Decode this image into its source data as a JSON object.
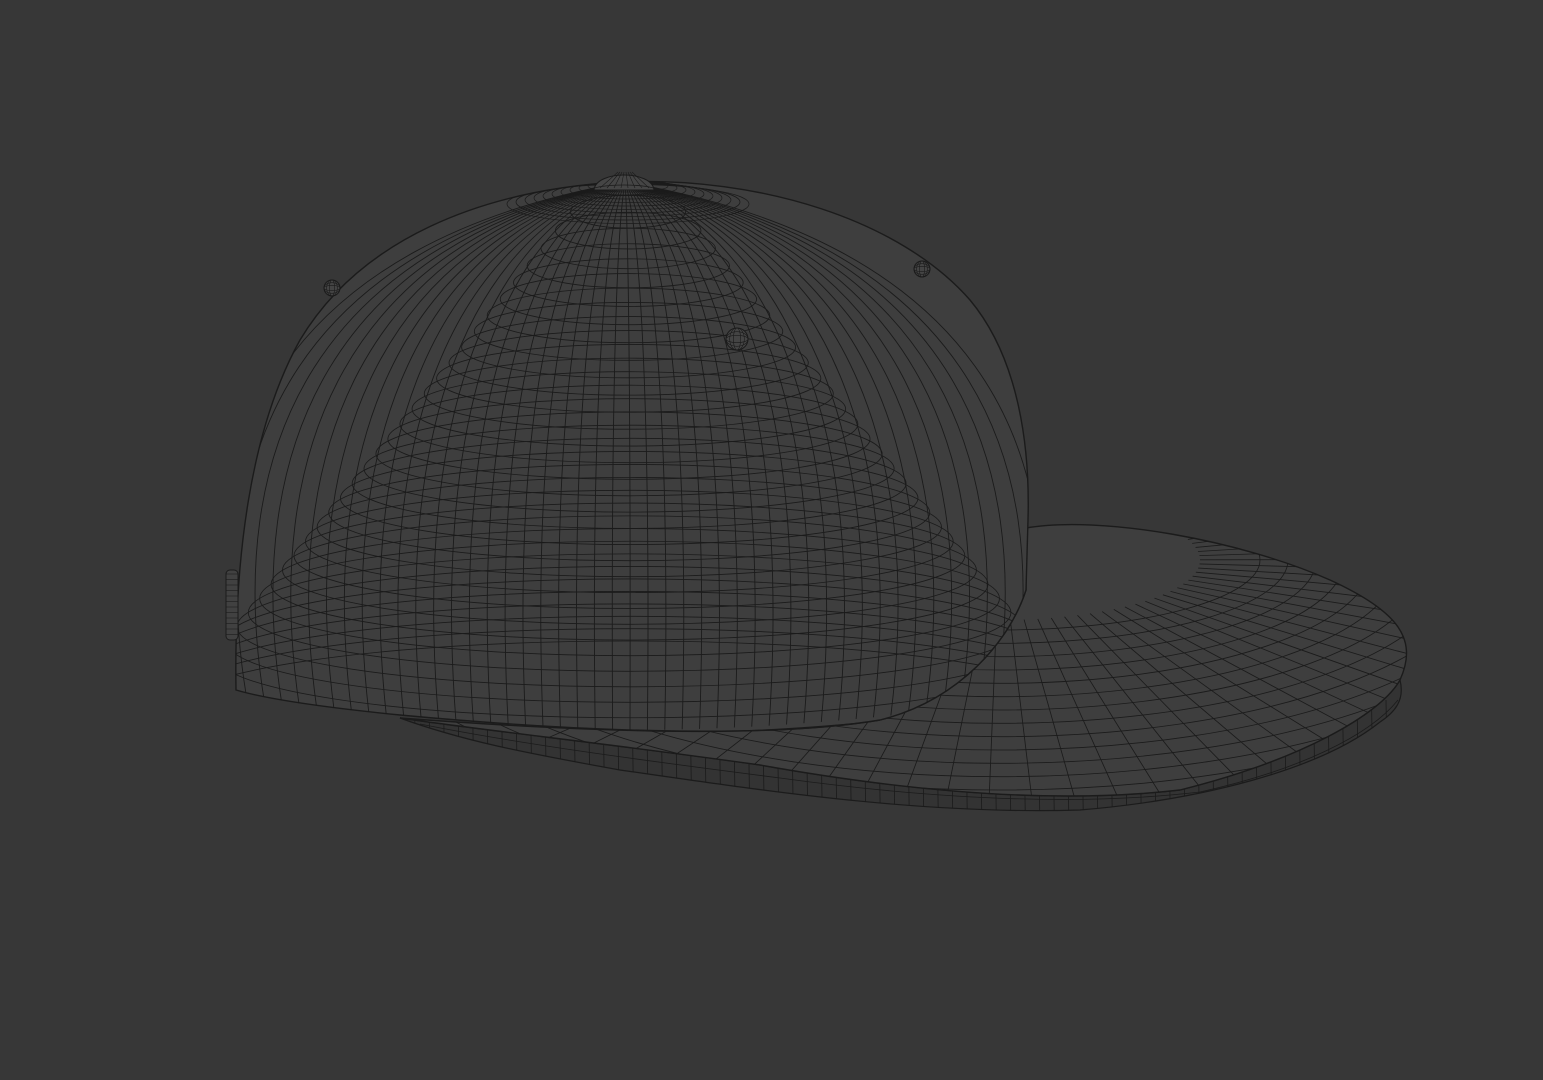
{
  "scene": {
    "subject": "baseball-cap-wireframe",
    "colors": {
      "background": "#373737",
      "surface": "#3e3e3e",
      "surface_shadow": "#333333",
      "wire": "#1b1b1b",
      "wire_light": "#2a2a2a"
    }
  }
}
